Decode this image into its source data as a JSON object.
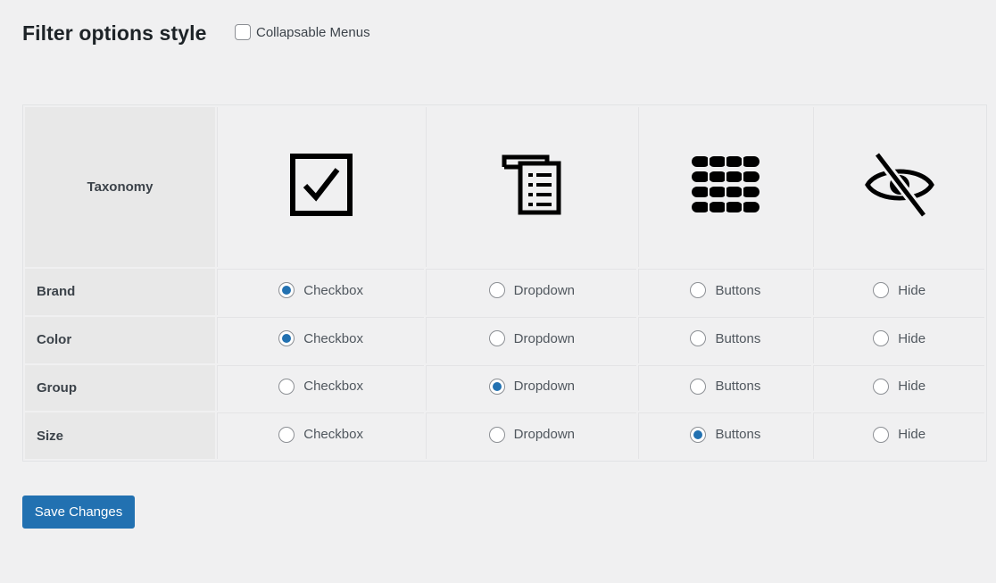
{
  "header": {
    "title": "Filter options style",
    "collapsable_label": "Collapsable Menus",
    "collapsable_checked": false
  },
  "table": {
    "taxonomy_header": "Taxonomy",
    "columns": [
      {
        "key": "checkbox",
        "icon": "checkbox-icon"
      },
      {
        "key": "dropdown",
        "icon": "dropdown-list-icon"
      },
      {
        "key": "buttons",
        "icon": "buttons-grid-icon"
      },
      {
        "key": "hide",
        "icon": "eye-slash-icon"
      }
    ],
    "option_labels": [
      "Checkbox",
      "Dropdown",
      "Buttons",
      "Hide"
    ],
    "rows": [
      {
        "label": "Brand",
        "selected": "Checkbox"
      },
      {
        "label": "Color",
        "selected": "Checkbox"
      },
      {
        "label": "Group",
        "selected": "Dropdown"
      },
      {
        "label": "Size",
        "selected": "Buttons"
      }
    ]
  },
  "footer": {
    "save_label": "Save Changes"
  },
  "colors": {
    "accent": "#2271b1",
    "background": "#f0f0f1",
    "label_cell": "#e8e8e8"
  }
}
